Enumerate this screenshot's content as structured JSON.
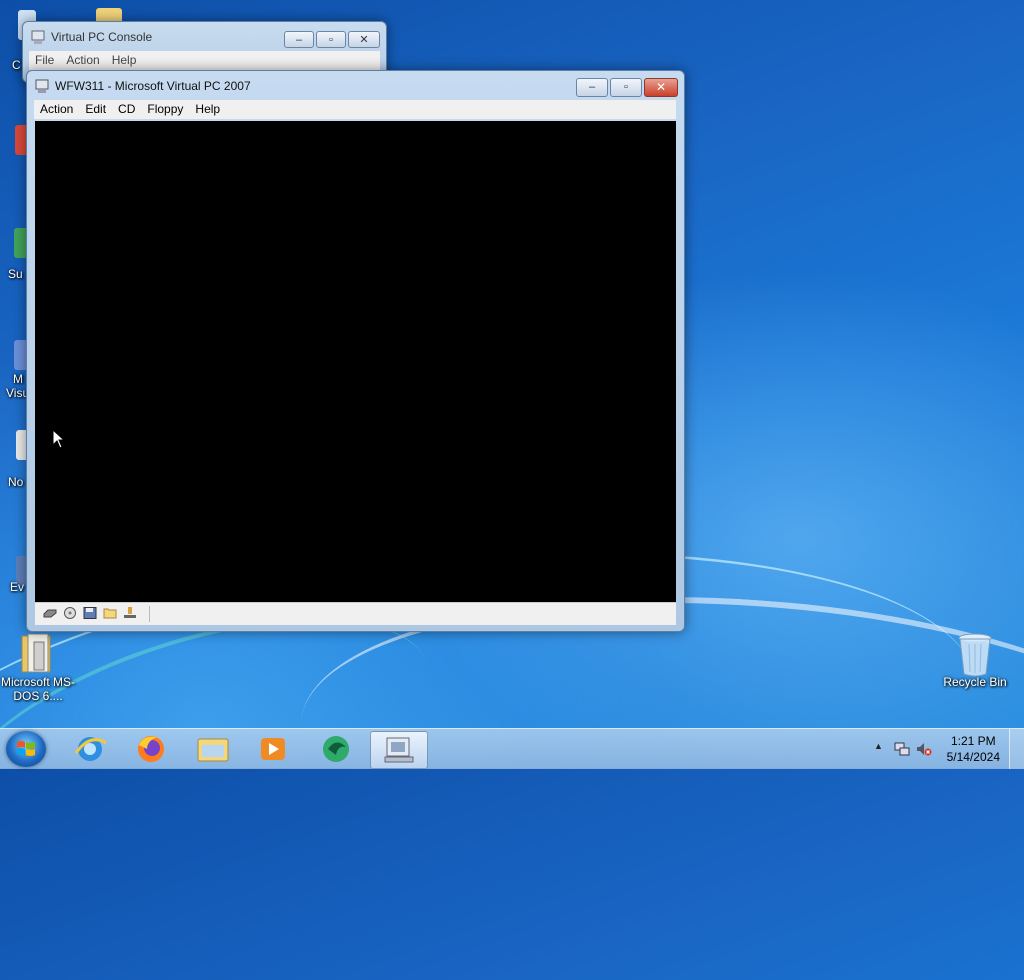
{
  "desktop": {
    "icons": [
      {
        "label": "Microsoft MS-DOS 6...."
      },
      {
        "label": "Recycle Bin"
      }
    ],
    "partial_labels": [
      "C",
      "Su",
      "M",
      "Visu",
      "No",
      "Ev"
    ]
  },
  "console_window": {
    "title": "Virtual PC Console",
    "menu": [
      "File",
      "Action",
      "Help"
    ]
  },
  "vm_window": {
    "title": "WFW311 - Microsoft Virtual PC 2007",
    "menu": [
      "Action",
      "Edit",
      "CD",
      "Floppy",
      "Help"
    ],
    "status_icons": [
      "hard-disk-icon",
      "cd-drive-icon",
      "floppy-icon",
      "shared-folder-icon",
      "network-icon"
    ]
  },
  "taskbar": {
    "pinned": [
      "internet-explorer-icon",
      "firefox-icon",
      "windows-explorer-icon",
      "media-player-icon",
      "app-green-icon",
      "virtual-pc-icon"
    ],
    "clock_time": "1:21 PM",
    "clock_date": "5/14/2024"
  },
  "colors": {
    "vm_screen": "#000000",
    "close_button": "#c9402b"
  }
}
